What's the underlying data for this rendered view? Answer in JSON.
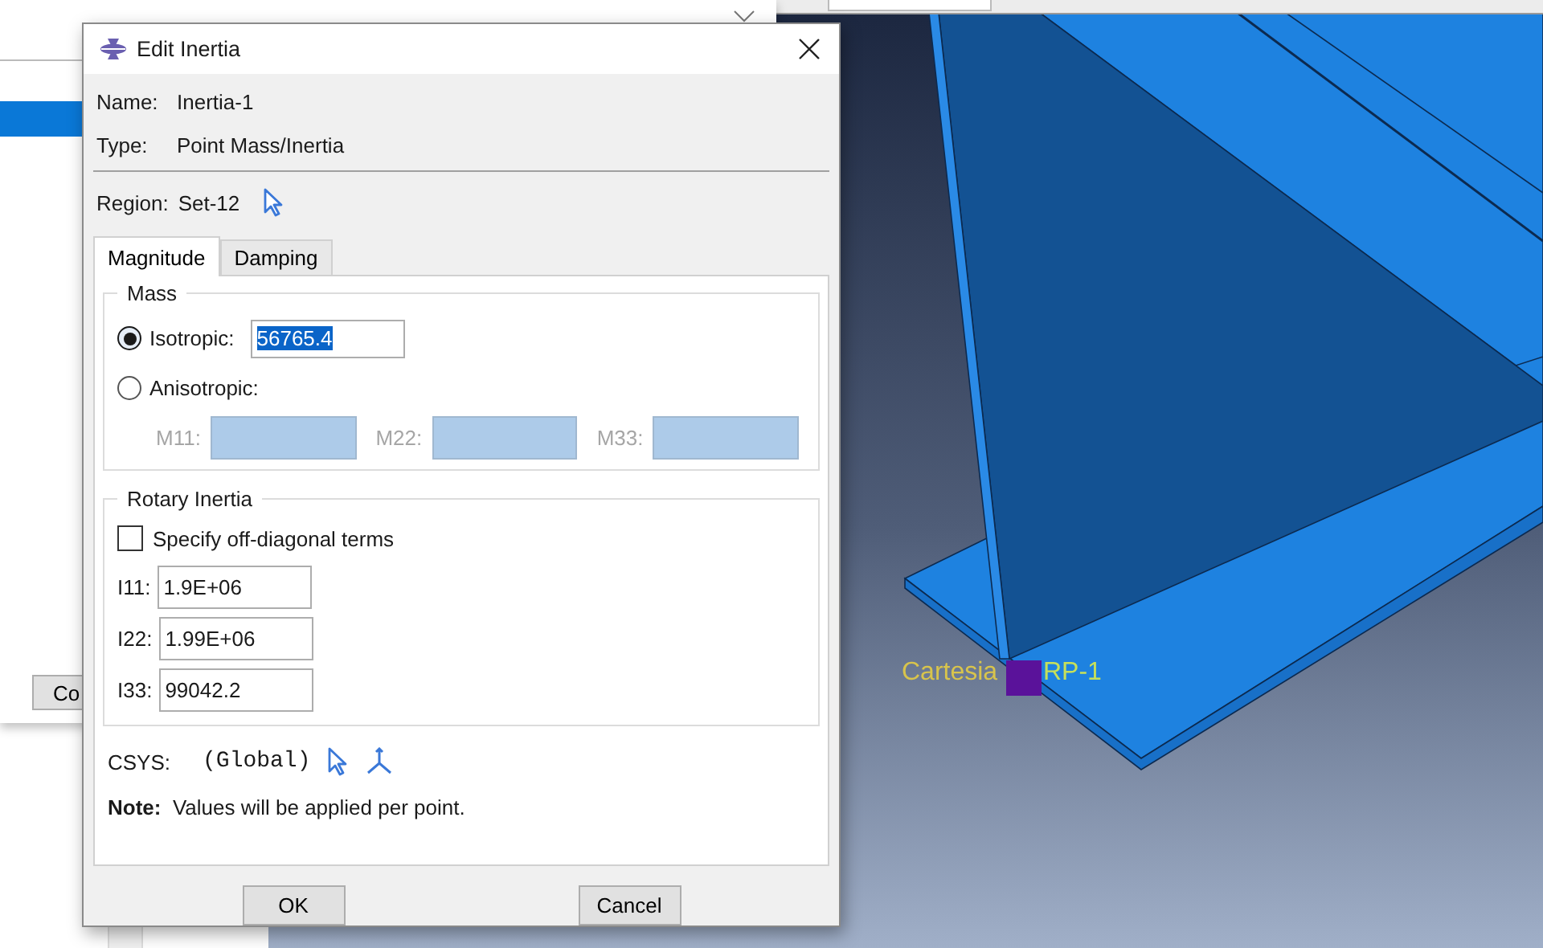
{
  "background_window": {
    "list": [
      {
        "selected": true
      }
    ],
    "button": "Co"
  },
  "viewport": {
    "labels": [
      {
        "text": "Cartesia",
        "color": "#d8c44c"
      },
      {
        "text": "RP-1",
        "color": "#c6e05a"
      }
    ]
  },
  "dialog": {
    "title": "Edit Inertia",
    "info": [
      {
        "label": "Name:",
        "value": "Inertia-1"
      },
      {
        "label": "Type:",
        "value": "Point Mass/Inertia"
      }
    ],
    "region": {
      "label": "Region:",
      "value": "Set-12"
    },
    "tabs": [
      {
        "label": "Magnitude",
        "selected": true
      },
      {
        "label": "Damping",
        "selected": false
      }
    ],
    "mass": {
      "title": "Mass",
      "options": [
        {
          "label": "Isotropic:",
          "selected": true,
          "value": "56765.4",
          "highlighted": true
        },
        {
          "label": "Anisotropic:",
          "selected": false
        }
      ],
      "components": [
        {
          "label": "M11:",
          "disabled": true
        },
        {
          "label": "M22:",
          "disabled": true
        },
        {
          "label": "M33:",
          "disabled": true
        }
      ]
    },
    "rotary_inertia": {
      "title": "Rotary Inertia",
      "off_diagonal": {
        "label": "Specify off-diagonal terms",
        "checked": false
      },
      "fields": [
        {
          "label": "I11:",
          "value": "1.9E+06"
        },
        {
          "label": "I22:",
          "value": "1.99E+06"
        },
        {
          "label": "I33:",
          "value": "99042.2"
        }
      ]
    },
    "csys": {
      "label": "CSYS:",
      "value": "(Global)"
    },
    "note": "**Note:**  Values will be applied per point.",
    "buttons": [
      "OK",
      "Cancel"
    ]
  }
}
